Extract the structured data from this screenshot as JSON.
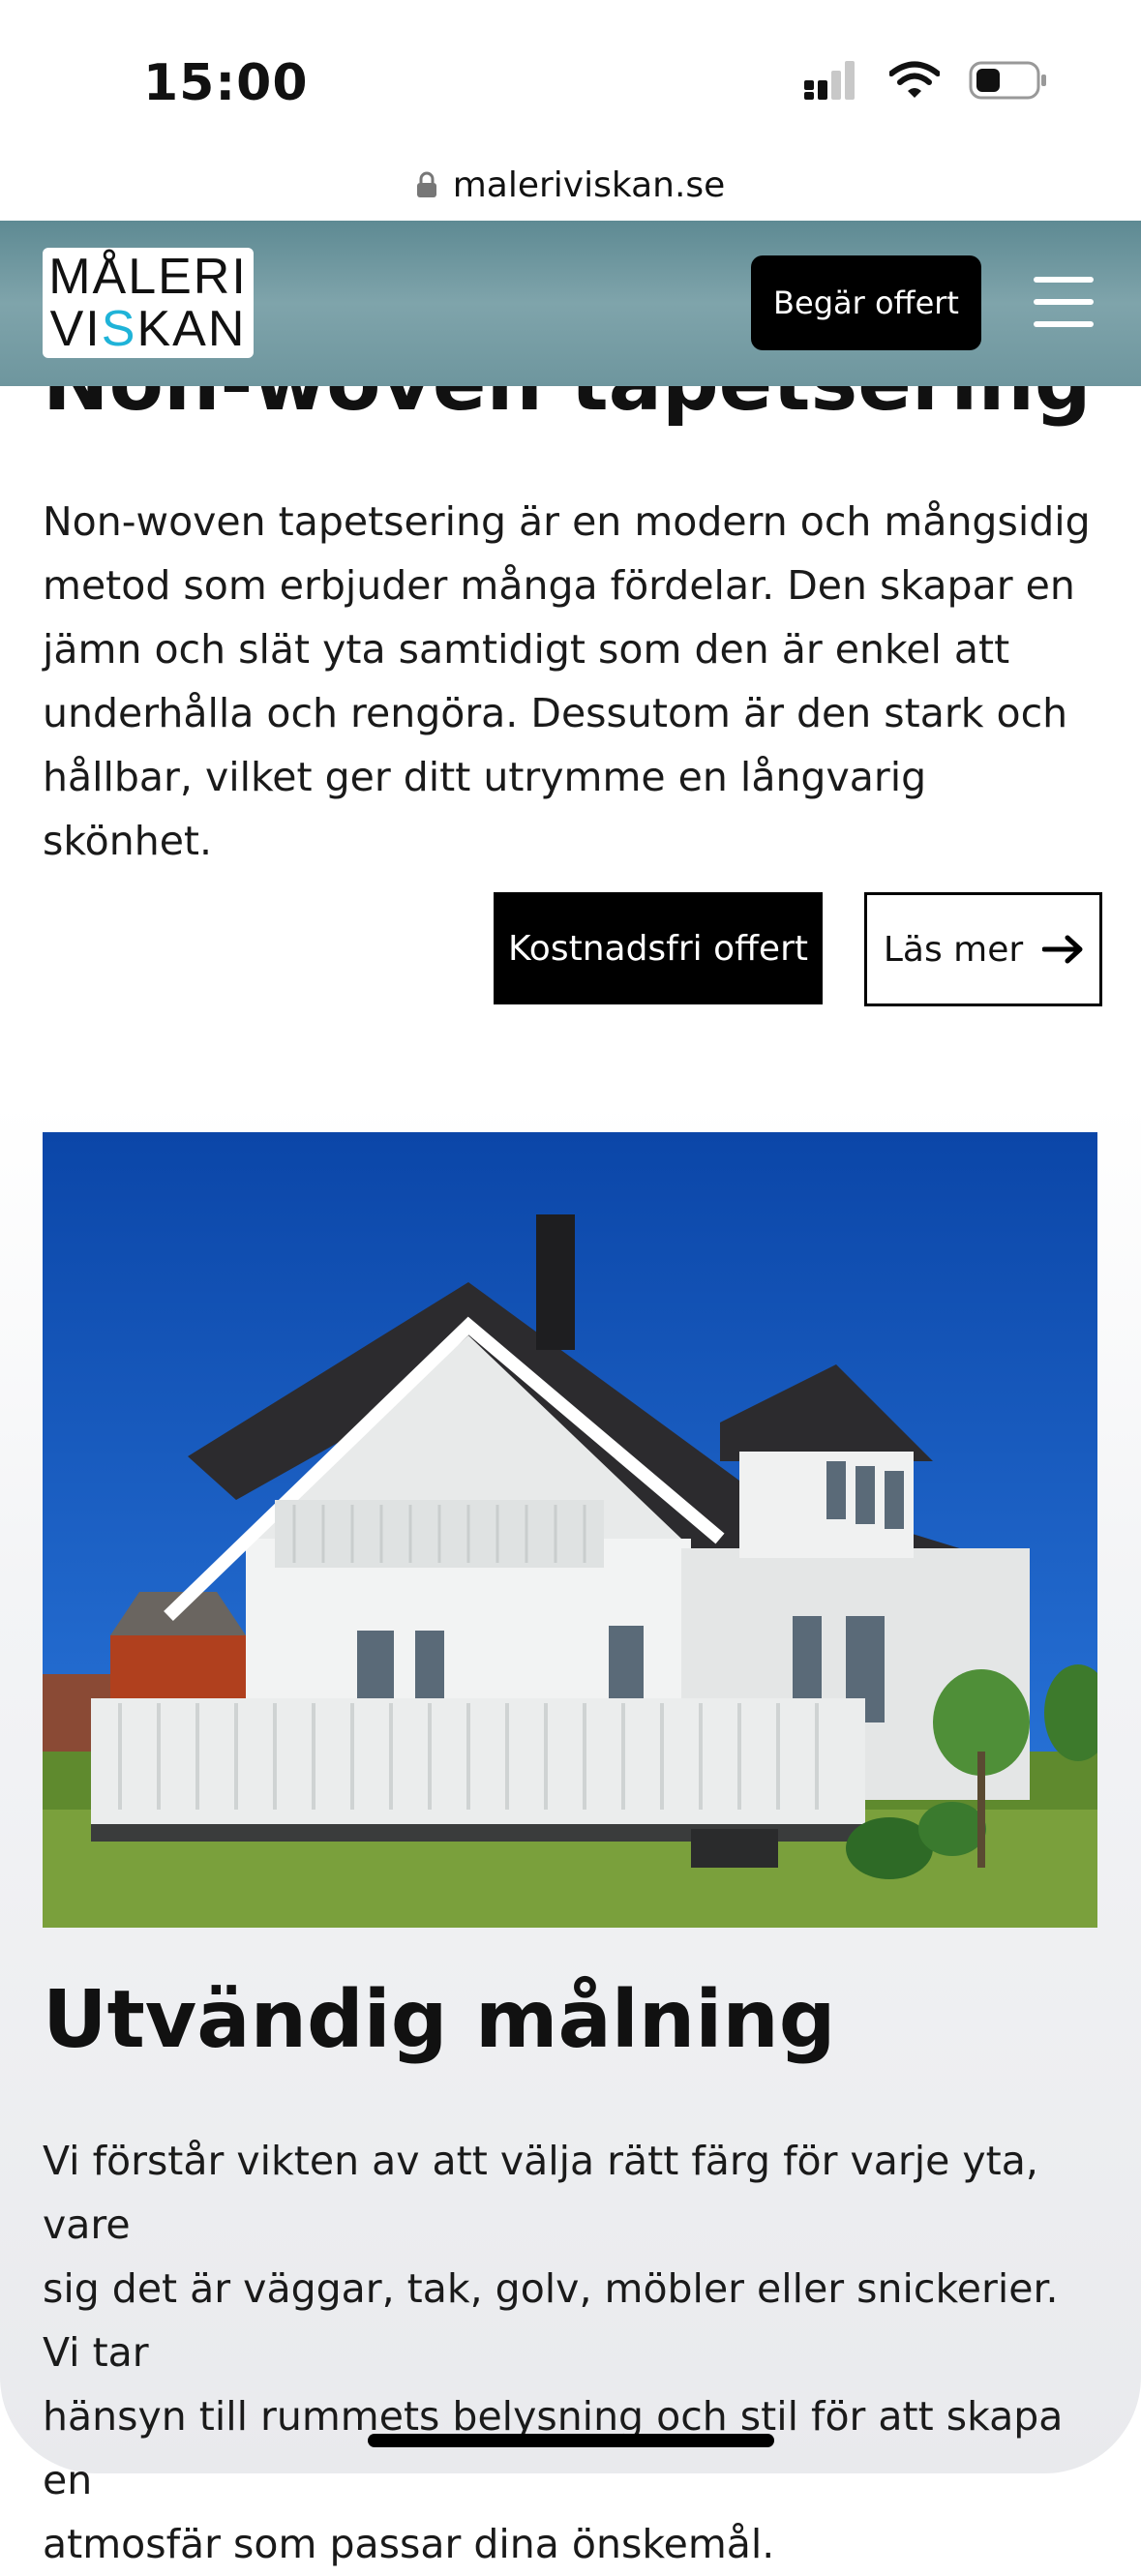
{
  "status_bar": {
    "time": "15:00"
  },
  "browser": {
    "url": "maleriviskan.se"
  },
  "nav": {
    "logo_line1": "MÅLERI",
    "logo_line2_a": "VI",
    "logo_line2_accent": "S",
    "logo_line2_b": "KAN",
    "cta_label": "Begär offert"
  },
  "section1": {
    "heading": "Non-woven tapetsering",
    "paragraph_lines": [
      "Non-woven tapetsering är en modern och mångsidig",
      "metod som erbjuder många fördelar. Den skapar en",
      "jämn och slät yta samtidigt som den är enkel att",
      "underhålla och rengöra. Dessutom är den stark och",
      "hållbar, vilket ger ditt utrymme en långvarig skönhet."
    ],
    "primary_button": "Kostnadsfri offert",
    "secondary_button": "Läs mer"
  },
  "section2": {
    "heading": "Utvändig målning",
    "paragraph_lines": [
      "Vi förstår vikten av att välja rätt färg för varje yta, vare",
      "sig det är väggar, tak, golv, möbler eller snickerier. Vi tar",
      "hänsyn till rummets belysning och stil för att skapa en",
      "atmosfär som passar dina önskemål."
    ]
  },
  "colors": {
    "nav_teal": "#6e969e",
    "logo_accent": "#1fb3d8",
    "button_black": "#000000",
    "sky_blue": "#0f4fb3"
  },
  "icons": [
    "lock-icon",
    "cellular-signal-icon",
    "wifi-icon",
    "battery-icon",
    "menu-icon",
    "arrow-right-icon"
  ]
}
